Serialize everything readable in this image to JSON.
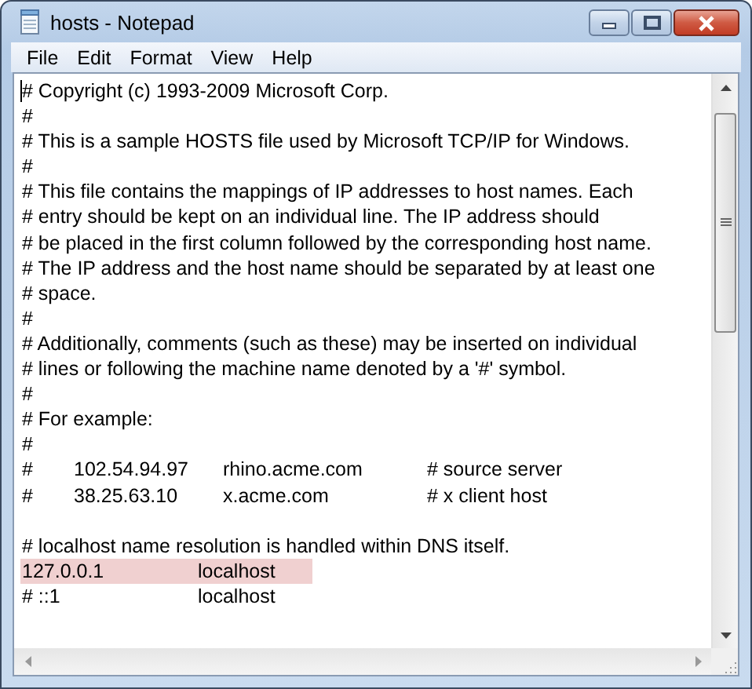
{
  "window": {
    "title": "hosts - Notepad"
  },
  "menu": [
    "File",
    "Edit",
    "Format",
    "View",
    "Help"
  ],
  "lines": [
    {
      "kind": "text",
      "text": "# Copyright (c) 1993-2009 Microsoft Corp."
    },
    {
      "kind": "text",
      "text": "#"
    },
    {
      "kind": "text",
      "text": "# This is a sample HOSTS file used by Microsoft TCP/IP for Windows."
    },
    {
      "kind": "text",
      "text": "#"
    },
    {
      "kind": "text",
      "text": "# This file contains the mappings of IP addresses to host names. Each"
    },
    {
      "kind": "text",
      "text": "# entry should be kept on an individual line. The IP address should"
    },
    {
      "kind": "text",
      "text": "# be placed in the first column followed by the corresponding host name."
    },
    {
      "kind": "text",
      "text": "# The IP address and the host name should be separated by at least one"
    },
    {
      "kind": "text",
      "text": "# space."
    },
    {
      "kind": "text",
      "text": "#"
    },
    {
      "kind": "text",
      "text": "# Additionally, comments (such as these) may be inserted on individual"
    },
    {
      "kind": "text",
      "text": "# lines or following the machine name denoted by a '#' symbol."
    },
    {
      "kind": "text",
      "text": "#"
    },
    {
      "kind": "text",
      "text": "# For example:"
    },
    {
      "kind": "text",
      "text": "#"
    },
    {
      "kind": "example",
      "cells": [
        "#",
        "102.54.94.97",
        "rhino.acme.com",
        "# source server"
      ]
    },
    {
      "kind": "example",
      "cells": [
        "#",
        "38.25.63.10",
        "x.acme.com",
        "# x client host"
      ]
    },
    {
      "kind": "blank"
    },
    {
      "kind": "text",
      "text": "# localhost name resolution is handled within DNS itself."
    },
    {
      "kind": "entry",
      "cells": [
        "127.0.0.1",
        "localhost"
      ],
      "selected": true
    },
    {
      "kind": "entry",
      "cells": [
        "# ::1",
        "localhost"
      ],
      "selected": false
    }
  ]
}
